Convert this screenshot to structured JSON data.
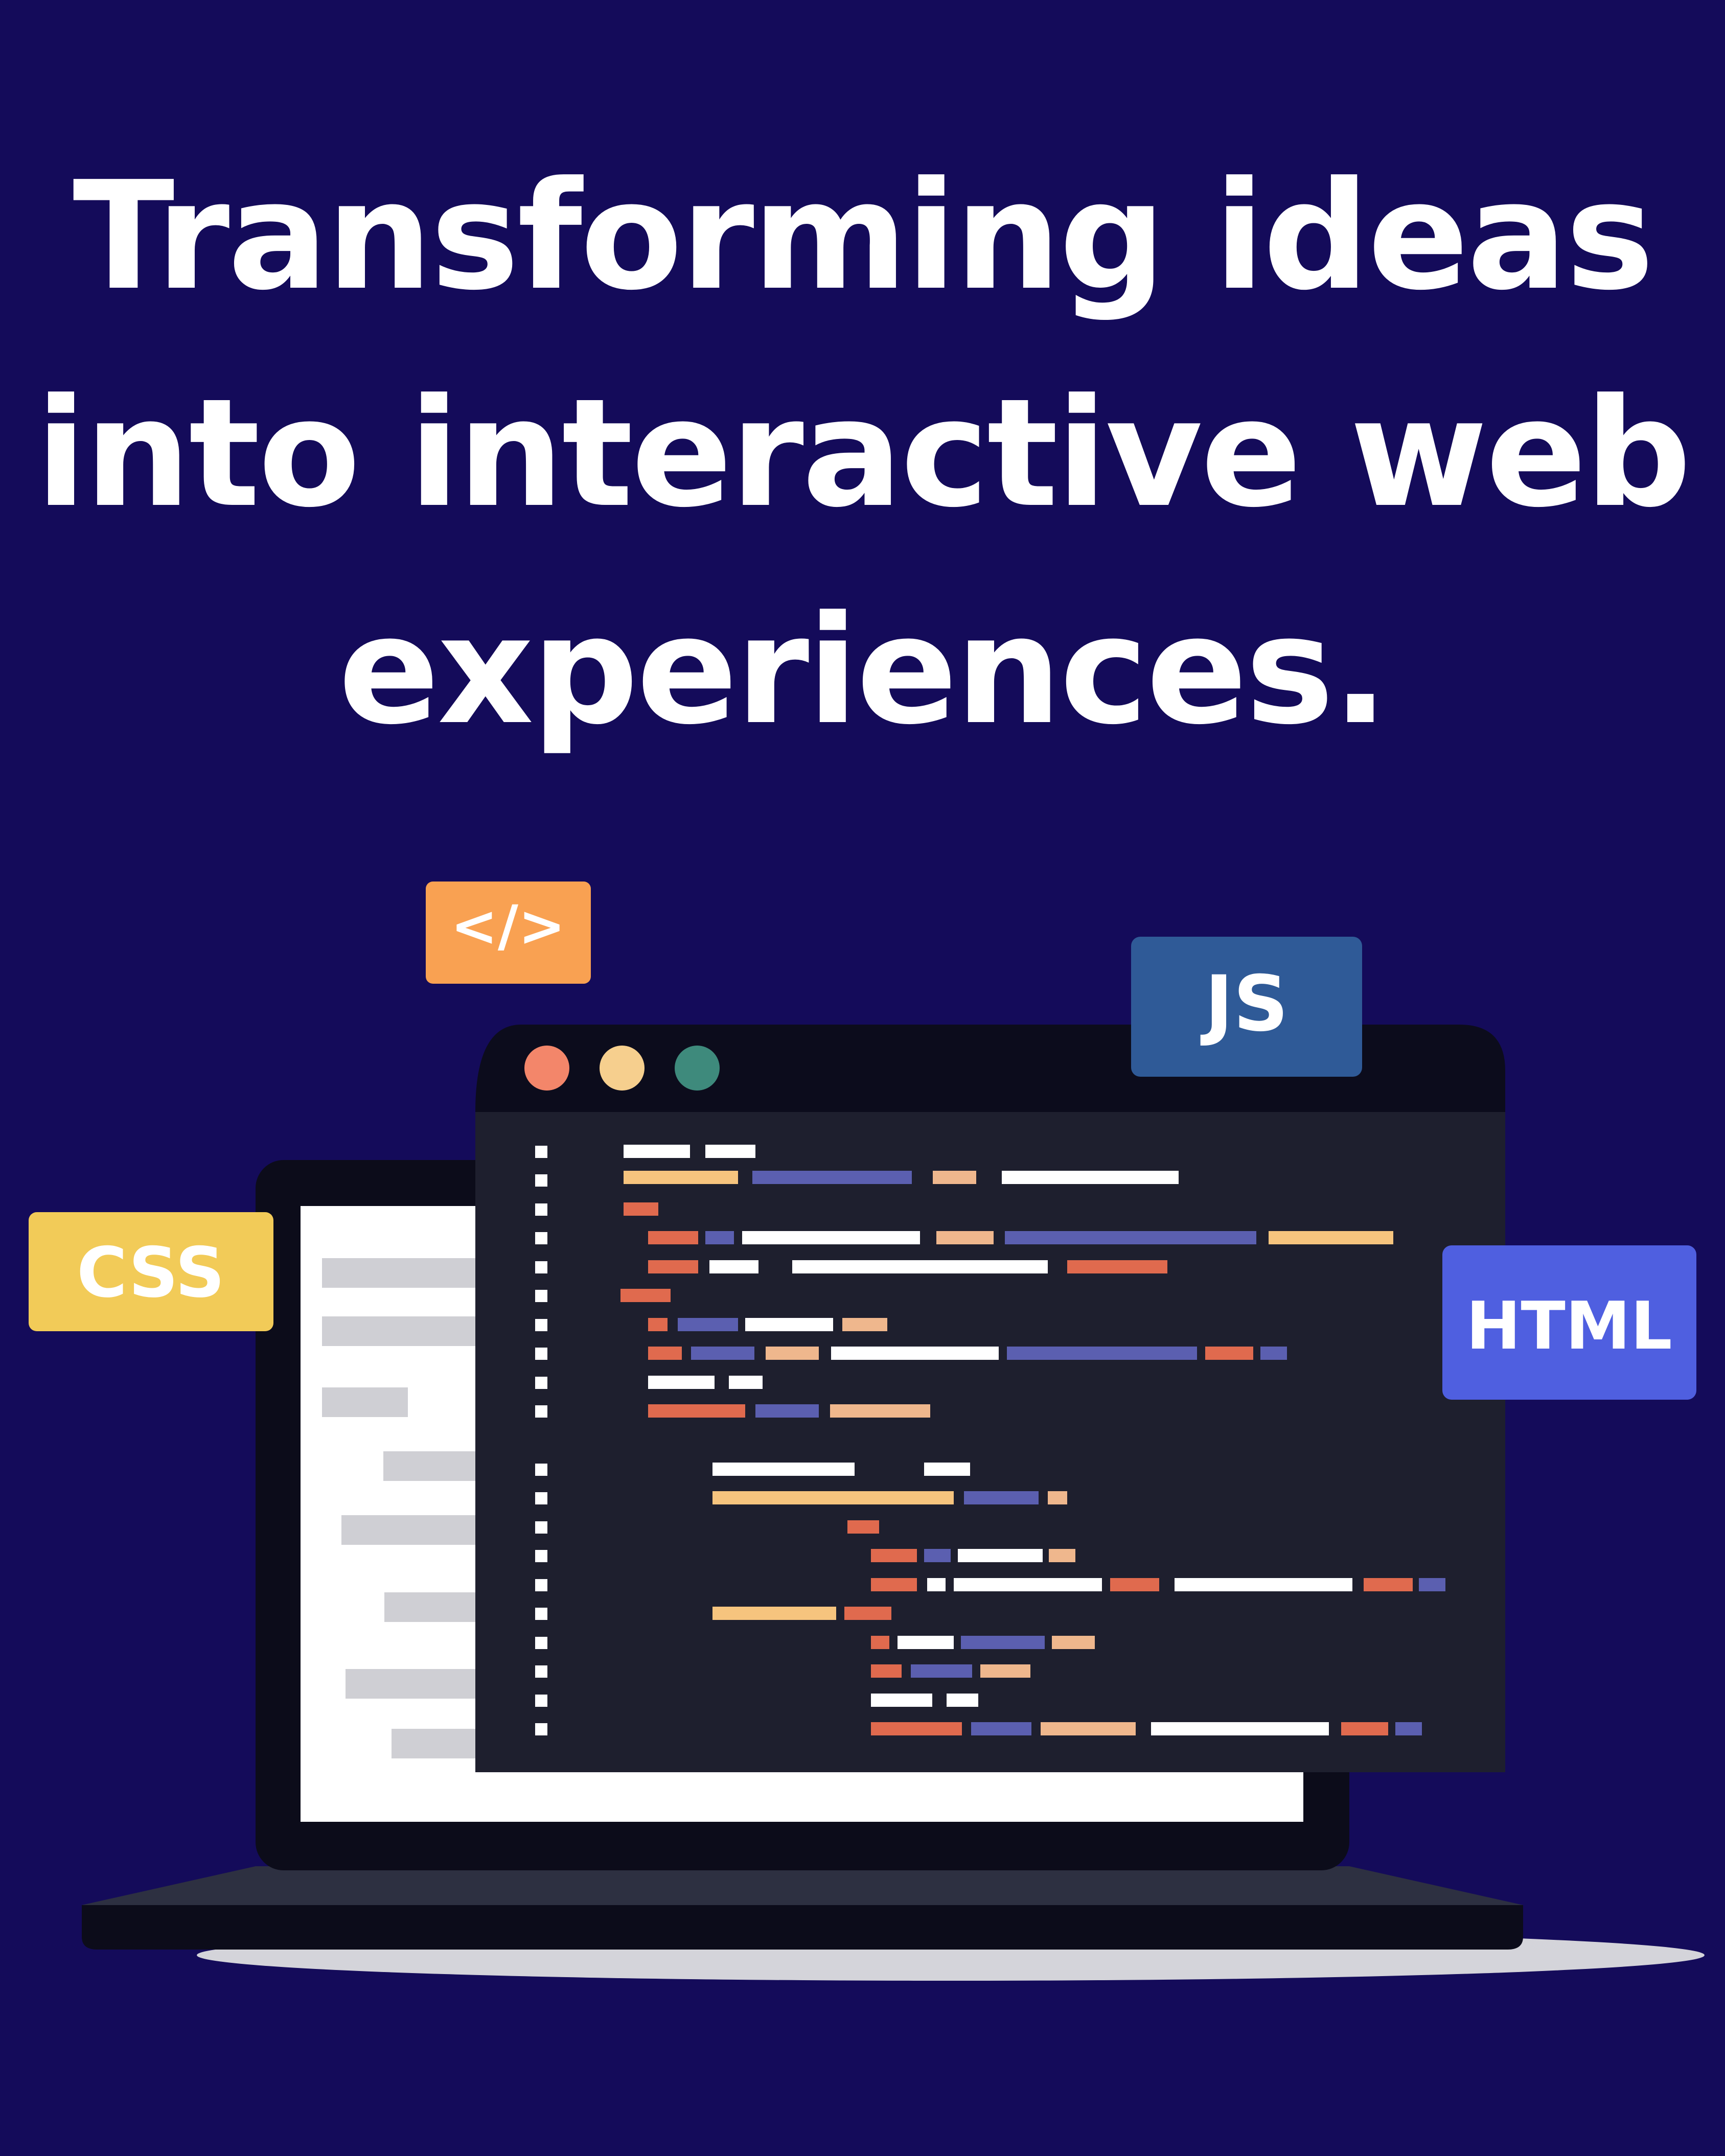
{
  "headline": {
    "line1": "Transforming ideas",
    "line2": "into interactive web",
    "line3": "experiences."
  },
  "badges": {
    "code": "</>",
    "js": "JS",
    "css": "CSS",
    "html": "HTML"
  },
  "colors": {
    "background": "#140b5a",
    "code_badge": "#f9a152",
    "js_badge": "#2f5a97",
    "css_badge": "#f2cb58",
    "html_badge": "#4f5fe0",
    "editor_bg": "#1e1f2e",
    "editor_bar": "#0c0c1c",
    "dot_red": "#f3866a",
    "dot_yellow": "#f6cf8e",
    "dot_teal": "#3e8a7c"
  },
  "icons": {
    "window_dots": "traffic-light-dots",
    "laptop": "laptop-illustration",
    "code_window": "code-editor-window"
  }
}
